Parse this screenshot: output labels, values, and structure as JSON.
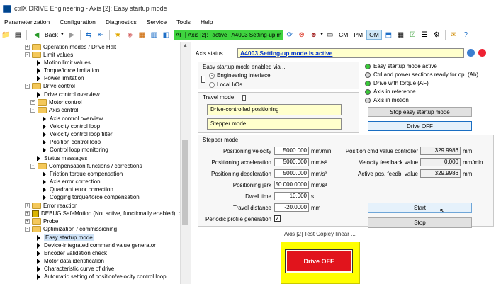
{
  "window": {
    "title": "ctrlX DRIVE Engineering - Axis [2]: Easy startup mode"
  },
  "menu": [
    "Parameterization",
    "Configuration",
    "Diagnostics",
    "Service",
    "Tools",
    "Help"
  ],
  "toolbar": {
    "back_label": "Back",
    "status": {
      "af": "AF",
      "axis": "Axis [2]:",
      "state": "active",
      "message": "A4003 Setting-up m"
    },
    "modes": [
      "CM",
      "PM",
      "OM"
    ],
    "active_mode": "OM"
  },
  "tree": {
    "items": [
      {
        "label": "Operation modes / Drive Halt",
        "type": "folder",
        "exp": "+"
      },
      {
        "label": "Limit values",
        "type": "folder",
        "exp": "-"
      },
      {
        "label": "Motion limit values",
        "type": "leaf"
      },
      {
        "label": "Torque/force limitation",
        "type": "leaf"
      },
      {
        "label": "Power limitation",
        "type": "leaf"
      },
      {
        "label": "Drive control",
        "type": "folder",
        "exp": "-"
      },
      {
        "label": "Drive control overview",
        "type": "leaf"
      },
      {
        "label": "Motor control",
        "type": "folder",
        "exp": "+"
      },
      {
        "label": "Axis control",
        "type": "folder",
        "exp": "-"
      },
      {
        "label": "Axis control overview",
        "type": "leaf"
      },
      {
        "label": "Velocity control loop",
        "type": "leaf"
      },
      {
        "label": "Velocity control loop filter",
        "type": "leaf"
      },
      {
        "label": "Position control loop",
        "type": "leaf"
      },
      {
        "label": "Control loop monitoring",
        "type": "leaf"
      },
      {
        "label": "Status messages",
        "type": "leaf"
      },
      {
        "label": "Compensation functions / corrections",
        "type": "folder",
        "exp": "-"
      },
      {
        "label": "Friction torque compensation",
        "type": "leaf"
      },
      {
        "label": "Axis error correction",
        "type": "leaf"
      },
      {
        "label": "Quadrant error correction",
        "type": "leaf"
      },
      {
        "label": "Cogging torque/force compensation",
        "type": "leaf"
      },
      {
        "label": "Error reaction",
        "type": "folder",
        "exp": "+"
      },
      {
        "label": "DEBUG SafeMotion (Not active, functionally enabled): def",
        "type": "debug",
        "exp": "+"
      },
      {
        "label": "Probe",
        "type": "folder",
        "exp": "+"
      },
      {
        "label": "Optimization / commissioning",
        "type": "folder",
        "exp": "-"
      },
      {
        "label": "Easy startup mode",
        "type": "leaf",
        "selected": true
      },
      {
        "label": "Device-integrated command value generator",
        "type": "leaf"
      },
      {
        "label": "Encoder validation check",
        "type": "leaf"
      },
      {
        "label": "Motor data identification",
        "type": "leaf"
      },
      {
        "label": "Characteristic curve of drive",
        "type": "leaf"
      },
      {
        "label": "Automatic setting of position/velocity control loop...",
        "type": "leaf"
      }
    ]
  },
  "axis_status": {
    "label": "Axis status",
    "value": "A4003 Setting-up mode is active"
  },
  "enable_group": {
    "title": "Easy startup mode enabled via ...",
    "options": [
      "Engineering interface",
      "Local I/Os"
    ]
  },
  "status_list": [
    {
      "label": "Easy startup mode active",
      "led": "green"
    },
    {
      "label": "Ctrl and power sections ready for op. (Ab)",
      "led": "gray"
    },
    {
      "label": "Drive with torque (AF)",
      "led": "green"
    },
    {
      "label": "Axis in reference",
      "led": "green"
    },
    {
      "label": "Axis in motion",
      "led": "gray"
    }
  ],
  "travel_mode": {
    "title": "Travel mode",
    "field1": "Drive-controlled positioning",
    "field2": "Stepper mode"
  },
  "buttons": {
    "stop_easy": "Stop easy startup mode",
    "drive_off": "Drive OFF",
    "start": "Start",
    "stop": "Stop"
  },
  "stepper": {
    "title": "Stepper mode",
    "params": [
      {
        "label": "Positioning velocity",
        "value": "5000.000",
        "unit": "mm/min"
      },
      {
        "label": "Positioning acceleration",
        "value": "5000.000",
        "unit": "mm/s²"
      },
      {
        "label": "Positioning deceleration",
        "value": "5000.000",
        "unit": "mm/s²"
      },
      {
        "label": "Positioning jerk",
        "value": "50 000.0000",
        "unit": "mm/s³"
      },
      {
        "label": "Dwell time",
        "value": "10.000",
        "unit": "s"
      },
      {
        "label": "Travel distance",
        "value": "-20.0000",
        "unit": "mm"
      }
    ],
    "periodic_label": "Periodic profile generation",
    "periodic_checked": "✓",
    "readouts": [
      {
        "label": "Position cmd value controller",
        "value": "329.9986",
        "unit": "mm"
      },
      {
        "label": "Velocity feedback value",
        "value": "0.000",
        "unit": "mm/min"
      },
      {
        "label": "Active pos. feedb. value",
        "value": "329.9986",
        "unit": "mm"
      }
    ]
  },
  "popup": {
    "title": "Axis [2] Test Copley linear ...",
    "button": "Drive OFF"
  },
  "colors": {
    "status_green": "#3fd43f",
    "field_yellow": "#ffffcc",
    "popup_yellow": "#ffff00",
    "drive_off_red": "#e1141c"
  }
}
